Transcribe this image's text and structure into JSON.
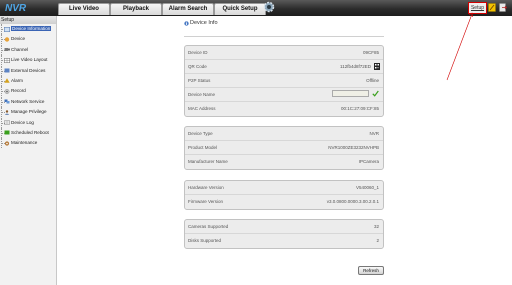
{
  "header": {
    "logo_text": "NVR",
    "tabs": [
      {
        "label": "Live Video"
      },
      {
        "label": "Playback"
      },
      {
        "label": "Alarm Search"
      },
      {
        "label": "Quick Setup"
      }
    ],
    "setup_link": "Setup"
  },
  "sidebar": {
    "heading": "Setup",
    "items": [
      {
        "label": "Device Information",
        "icon": "info-icon",
        "active": true
      },
      {
        "label": "Device",
        "icon": "device-icon"
      },
      {
        "label": "Channel",
        "icon": "camera-icon"
      },
      {
        "label": "Live Video Layout",
        "icon": "layout-icon"
      },
      {
        "label": "External Devices",
        "icon": "external-device-icon"
      },
      {
        "label": "Alarm",
        "icon": "alarm-icon"
      },
      {
        "label": "Record",
        "icon": "record-icon"
      },
      {
        "label": "Network Service",
        "icon": "network-icon"
      },
      {
        "label": "Manage Privilege",
        "icon": "user-icon"
      },
      {
        "label": "Device Log",
        "icon": "log-icon"
      },
      {
        "label": "Scheduled Reboot",
        "icon": "reboot-icon"
      },
      {
        "label": "Maintenance",
        "icon": "maintenance-icon"
      }
    ]
  },
  "main": {
    "title": "Device Info",
    "panel1": {
      "device_id_label": "Device ID",
      "device_id": "09CF85",
      "qr_label": "QR Code",
      "qr_value": "112fb4d8f72ED",
      "p2p_label": "P2P Status",
      "p2p_value": "Offline",
      "name_label": "Device Name",
      "name_value": "",
      "mac_label": "MAC Address",
      "mac_value": "00:1C:27:09:CF:85"
    },
    "panel2": {
      "type_label": "Device Type",
      "type_value": "NVR",
      "model_label": "Product Model",
      "model_value": "NVR1000ZE3232NVHPB",
      "mfr_label": "Manufacturer Name",
      "mfr_value": "IPCamera"
    },
    "panel3": {
      "hw_label": "Hardware Version",
      "hw_value": "V540060_1",
      "fw_label": "Firmware Version",
      "fw_value": "v3.0.0800.0000.3.00.2.0.1"
    },
    "panel4": {
      "cams_label": "Cameras Supported",
      "cams_value": "32",
      "disks_label": "Disks Supported",
      "disks_value": "2"
    },
    "refresh_label": "Refresh"
  },
  "colors": {
    "accent_active": "#3a64b4",
    "annotation_red": "#d20000",
    "check_green": "#3aa01d"
  }
}
